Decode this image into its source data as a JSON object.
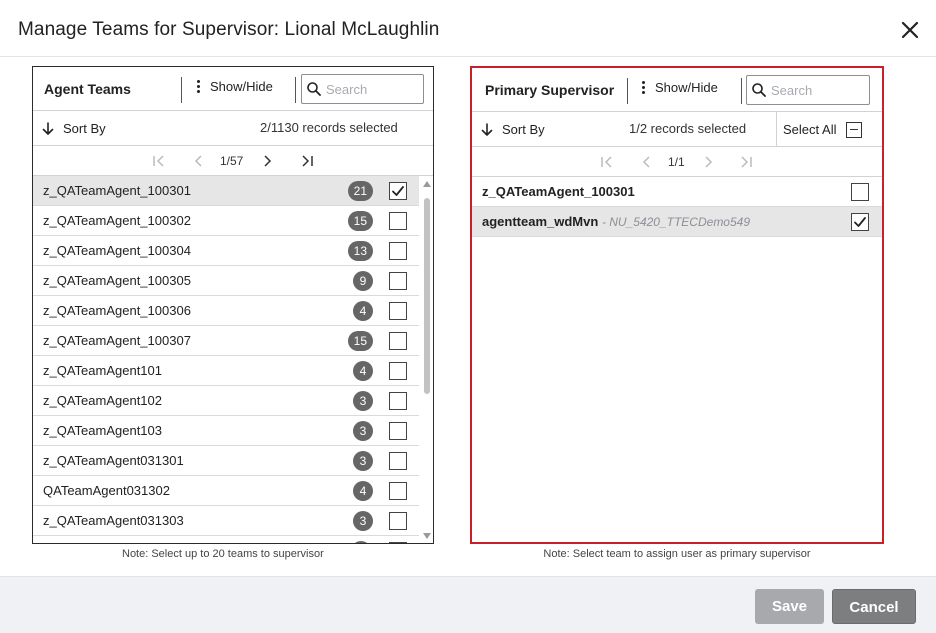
{
  "dialog": {
    "title": "Manage Teams for Supervisor: Lional McLaughlin"
  },
  "left_panel": {
    "title": "Agent Teams",
    "show_hide": "Show/Hide",
    "search_placeholder": "Search",
    "sort_by": "Sort By",
    "records_text": "2/1130 records selected",
    "pager_text": "1/57",
    "note": "Note: Select up to 20 teams to supervisor",
    "rows": [
      {
        "label": "z_QATeamAgent_100301",
        "count": "21",
        "checked": true,
        "selected": true
      },
      {
        "label": "z_QATeamAgent_100302",
        "count": "15",
        "checked": false
      },
      {
        "label": "z_QATeamAgent_100304",
        "count": "13",
        "checked": false
      },
      {
        "label": "z_QATeamAgent_100305",
        "count": "9",
        "checked": false
      },
      {
        "label": "z_QATeamAgent_100306",
        "count": "4",
        "checked": false
      },
      {
        "label": "z_QATeamAgent_100307",
        "count": "15",
        "checked": false
      },
      {
        "label": "z_QATeamAgent101",
        "count": "4",
        "checked": false
      },
      {
        "label": "z_QATeamAgent102",
        "count": "3",
        "checked": false
      },
      {
        "label": "z_QATeamAgent103",
        "count": "3",
        "checked": false
      },
      {
        "label": "z_QATeamAgent031301",
        "count": "3",
        "checked": false
      },
      {
        "label": "QATeamAgent031302",
        "count": "4",
        "checked": false
      },
      {
        "label": "z_QATeamAgent031303",
        "count": "3",
        "checked": false
      }
    ]
  },
  "right_panel": {
    "title": "Primary Supervisor",
    "show_hide": "Show/Hide",
    "search_placeholder": "Search",
    "sort_by": "Sort By",
    "records_text": "1/2 records selected",
    "select_all": "Select All",
    "pager_text": "1/1",
    "note": "Note: Select team to assign user as primary supervisor",
    "rows": [
      {
        "label": "z_QATeamAgent_100301",
        "sub": "",
        "checked": false,
        "selected": false
      },
      {
        "label": "agentteam_wdMvn",
        "sub": "- NU_5420_TTECDemo549",
        "checked": true,
        "selected": true
      }
    ]
  },
  "footer": {
    "save": "Save",
    "cancel": "Cancel"
  },
  "colors": {
    "accent_border": "#c9212a",
    "badge": "#666666",
    "selected_row": "#e6e6e6"
  },
  "icons": [
    "close-icon",
    "kebab-icon",
    "search-icon",
    "sort-arrow-icon",
    "first-page-icon",
    "prev-page-icon",
    "next-page-icon",
    "last-page-icon",
    "checkmark-icon",
    "minus-checkbox-icon"
  ]
}
